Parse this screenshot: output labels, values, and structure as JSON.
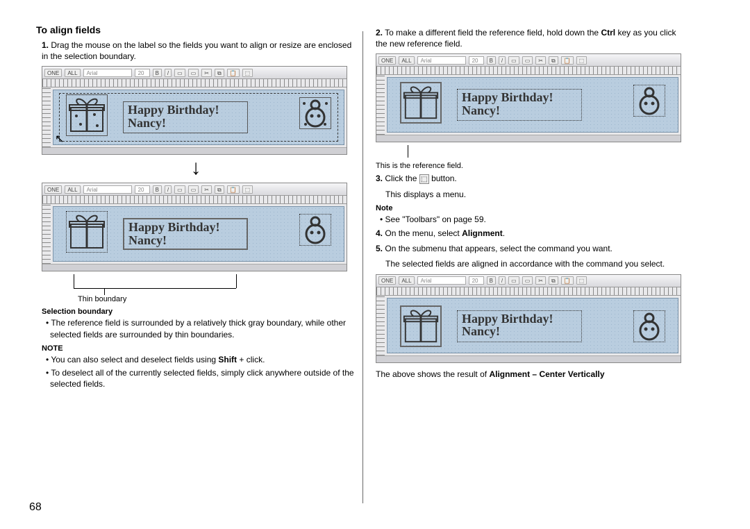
{
  "page_number": "68",
  "left": {
    "title": "To align fields",
    "step1_num": "1.",
    "step1": "Drag the mouse on the label so the fields you want to align or resize are enclosed in the selection boundary.",
    "hb_line1": "Happy Birthday!",
    "hb_line2": "Nancy!",
    "thin_boundary_label": "Thin boundary",
    "sel_boundary_head": "Selection boundary",
    "sel_boundary_text": "The reference field is surrounded by a relatively thick gray boundary, while other selected fields are surrounded by thin boundaries.",
    "note_head": "NOTE",
    "note_b1_pre": "You can also select and deselect fields using ",
    "note_b1_bold": "Shift",
    "note_b1_post": " + click.",
    "note_b2": "To deselect all of the currently selected fields, simply click anywhere outside of the selected fields.",
    "toolbar_one": "ONE",
    "toolbar_all": "ALL",
    "toolbar_font": "Arial",
    "toolbar_size": "20"
  },
  "right": {
    "step2_num": "2.",
    "step2_pre": "To make a different field the reference field, hold down the ",
    "step2_bold": "Ctrl",
    "step2_post": " key as you click the new reference field.",
    "ref_caption": "This is the reference field.",
    "step3_num": "3.",
    "step3_pre": "Click the ",
    "step3_post": " button.",
    "step3_line2": "This displays a menu.",
    "note_head": "Note",
    "note_b1": "See \"Toolbars\" on page 59.",
    "step4_num": "4.",
    "step4_pre": "On the menu, select ",
    "step4_bold": "Alignment",
    "step4_post": ".",
    "step5_num": "5.",
    "step5_a": "On the submenu that appears, select the command you want.",
    "step5_b": "The selected fields are aligned in accordance with the command you select.",
    "result_pre": "The above shows the result of ",
    "result_bold": "Alignment – Center Vertically"
  }
}
